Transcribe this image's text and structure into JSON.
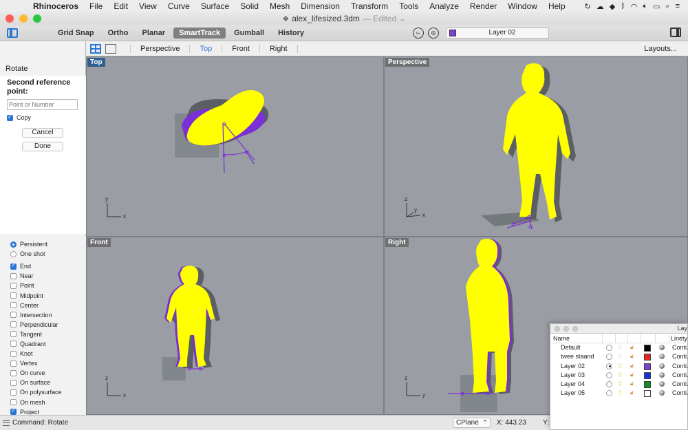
{
  "menubar": {
    "app_name": "Rhinoceros",
    "items": [
      "File",
      "Edit",
      "View",
      "Curve",
      "Surface",
      "Solid",
      "Mesh",
      "Dimension",
      "Transform",
      "Tools",
      "Analyze",
      "Render",
      "Window",
      "Help"
    ]
  },
  "window": {
    "title": "alex_lifesized.3dm",
    "edited": "— Edited ⌄"
  },
  "toolbar": {
    "tools": [
      "Grid Snap",
      "Ortho",
      "Planar",
      "SmartTrack",
      "Gumball",
      "History"
    ],
    "active_tool": "SmartTrack",
    "current_layer": "Layer 02",
    "current_layer_color": "#7b3fd1"
  },
  "viewport_tabs": {
    "tabs": [
      "Perspective",
      "Top",
      "Front",
      "Right"
    ],
    "active": "Top",
    "layouts_label": "Layouts..."
  },
  "command_panel": {
    "command": "Rotate",
    "prompt": "Second reference point:",
    "input_placeholder": "Point or Number",
    "copy_label": "Copy",
    "copy_checked": true,
    "cancel_label": "Cancel",
    "done_label": "Done"
  },
  "osnap": {
    "modes": [
      {
        "label": "Persistent",
        "checked": true
      },
      {
        "label": "One shot",
        "checked": false
      }
    ],
    "snaps": [
      {
        "label": "End",
        "checked": true
      },
      {
        "label": "Near",
        "checked": false
      },
      {
        "label": "Point",
        "checked": false
      },
      {
        "label": "Midpoint",
        "checked": false
      },
      {
        "label": "Center",
        "checked": false
      },
      {
        "label": "Intersection",
        "checked": false
      },
      {
        "label": "Perpendicular",
        "checked": false
      },
      {
        "label": "Tangent",
        "checked": false
      },
      {
        "label": "Quadrant",
        "checked": false
      },
      {
        "label": "Knot",
        "checked": false
      },
      {
        "label": "Vertex",
        "checked": false
      },
      {
        "label": "On curve",
        "checked": false
      },
      {
        "label": "On surface",
        "checked": false
      },
      {
        "label": "On polysurface",
        "checked": false
      },
      {
        "label": "On mesh",
        "checked": false
      },
      {
        "label": "Project",
        "checked": true
      }
    ]
  },
  "viewports": {
    "top": {
      "label": "Top",
      "axes": [
        "y",
        "x"
      ]
    },
    "perspective": {
      "label": "Perspective",
      "axes": [
        "z",
        "y",
        "x"
      ]
    },
    "front": {
      "label": "Front",
      "axes": [
        "z",
        "x"
      ]
    },
    "right": {
      "label": "Right",
      "axes": [
        "z",
        "y"
      ]
    }
  },
  "statusbar": {
    "command": "Command: Rotate",
    "cplane": "CPlane",
    "x": "X: 443.23",
    "y": "Y:"
  },
  "layers_panel": {
    "title": "Lay",
    "col_name": "Name",
    "col_linetype": "Linety",
    "layers": [
      {
        "name": "Default",
        "current": false,
        "visible": false,
        "color": "#000000",
        "linetype": "Conti."
      },
      {
        "name": "twee staand",
        "current": false,
        "visible": false,
        "color": "#e52420",
        "linetype": "Conti."
      },
      {
        "name": "Layer 02",
        "current": true,
        "visible": true,
        "color": "#7b3fd1",
        "linetype": "Conti."
      },
      {
        "name": "Layer 03",
        "current": false,
        "visible": true,
        "color": "#1834d8",
        "linetype": "Conti."
      },
      {
        "name": "Layer 04",
        "current": false,
        "visible": true,
        "color": "#158a2a",
        "linetype": "Conti."
      },
      {
        "name": "Layer 05",
        "current": false,
        "visible": true,
        "color": "#ffffff",
        "linetype": "Conti."
      }
    ]
  },
  "colors": {
    "model_yellow": "#ffff00",
    "model_purple": "#7b2fd6",
    "accent": "#2b76d3"
  }
}
